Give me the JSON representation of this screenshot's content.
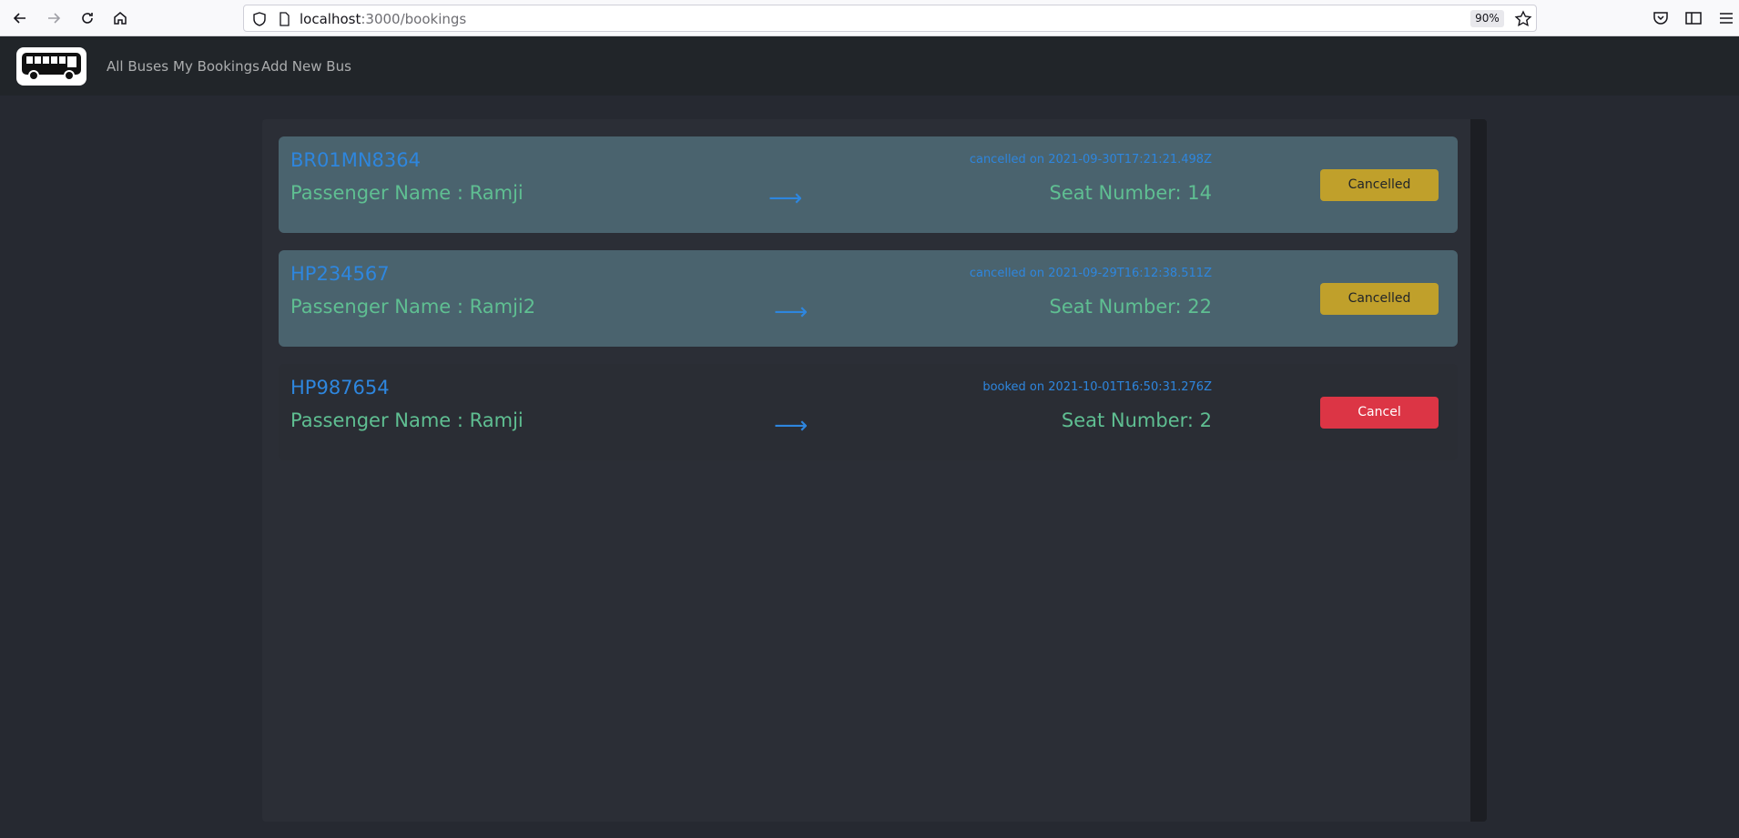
{
  "browser": {
    "url_host": "localhost",
    "url_path": ":3000/bookings",
    "zoom": "90%"
  },
  "navbar": {
    "links": [
      "All Buses",
      "My Bookings",
      "Add New Bus"
    ]
  },
  "bookings": [
    {
      "bus_number": "BR01MN8364",
      "passenger": "Passenger Name : Ramji",
      "arrow": "⟶",
      "status_time": "cancelled on 2021-09-30T17:21:21.498Z",
      "seat": "Seat Number: 14",
      "button_label": "Cancelled",
      "state": "cancelled"
    },
    {
      "bus_number": "HP234567",
      "passenger": "Passenger Name : Ramji2",
      "arrow": "⟶",
      "status_time": "cancelled on 2021-09-29T16:12:38.511Z",
      "seat": "Seat Number: 22",
      "button_label": "Cancelled",
      "state": "cancelled"
    },
    {
      "bus_number": "HP987654",
      "passenger": "Passenger Name : Ramji",
      "arrow": "⟶",
      "status_time": "booked on 2021-10-01T16:50:31.276Z",
      "seat": "Seat Number: 2",
      "button_label": "Cancel",
      "state": "booked"
    }
  ],
  "colors": {
    "card_cancelled": "#4a636e",
    "card_booked": "#2a2d34",
    "cancelled_button": "#c0a02b",
    "cancel_button": "#dc3545",
    "accent_blue": "#2e86de",
    "accent_green": "#5fbf92"
  }
}
